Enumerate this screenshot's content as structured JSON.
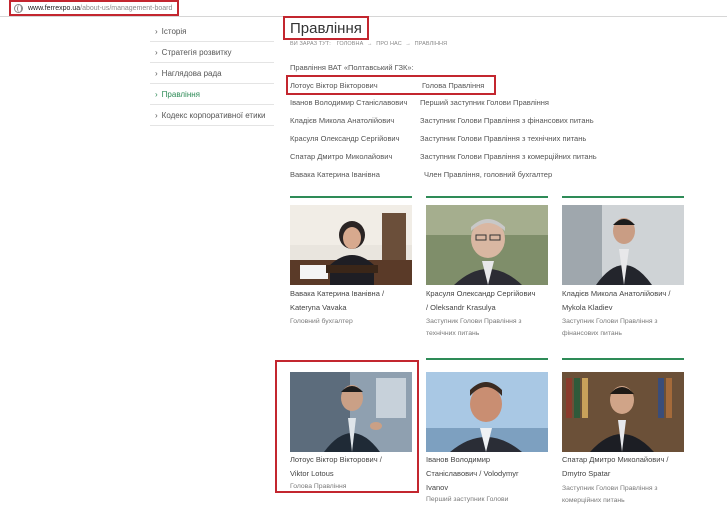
{
  "browser": {
    "url_host": "www.ferrexpo.ua",
    "url_path": "/about-us/management-board"
  },
  "sidebar": {
    "items": [
      {
        "label": "Історія",
        "active": false
      },
      {
        "label": "Стратегія розвитку",
        "active": false
      },
      {
        "label": "Наглядова рада",
        "active": false
      },
      {
        "label": "Правління",
        "active": true
      },
      {
        "label": "Кодекс корпоративної етики",
        "active": false
      }
    ]
  },
  "page": {
    "title": "Правління",
    "breadcrumb": [
      "Ви зараз тут:",
      "Головна",
      "Про нас",
      "Правління"
    ],
    "org_line": "Правління ВАТ «Полтавський ГЗК»:"
  },
  "board": [
    {
      "name": "Лотоус Віктор Вікторович",
      "position": "Голова Правління"
    },
    {
      "name": "Іванов Володимир Станіславович",
      "position": "Перший заступник Голови Правління"
    },
    {
      "name": "Кладієв Микола Анатолійович",
      "position": "Заступник Голови Правління  з фінансових питань"
    },
    {
      "name": "Красуля Олександр Сергійович",
      "position": "Заступник Голови Правління  з технічних питань"
    },
    {
      "name": "Спатар Дмитро Миколайович",
      "position": "Заступник Голови Правління  з комерційних питань"
    },
    {
      "name": "Вавака Катерина Іванівна",
      "position": "Член Правління, головний бухгалтер"
    }
  ],
  "cards": [
    {
      "name_lines": [
        "Вавака Катерина Іванівна /",
        "Kateryna Vavaka"
      ],
      "pos_lines": [
        "Головний бухгалтер"
      ],
      "photo": "woman-at-desk"
    },
    {
      "name_lines": [
        "Красуля Олександр Сергійович",
        "/ Oleksandr Krasulya"
      ],
      "pos_lines": [
        "Заступник Голови Правління з",
        "технічних питань"
      ],
      "photo": "man-glasses-outdoor"
    },
    {
      "name_lines": [
        "Кладієв Микола Анатолійович /",
        "Mykola Kladiev"
      ],
      "pos_lines": [
        "Заступник Голови Правління з",
        "фінансових питань"
      ],
      "photo": "man-office"
    },
    {
      "name_lines": [
        "Лотоус Віктор Вікторович /",
        "Viktor Lotous"
      ],
      "pos_lines": [
        "Голова Правління"
      ],
      "photo": "man-gesturing"
    },
    {
      "name_lines": [
        "Іванов Володимир",
        "Станіславович / Volodymyr",
        "Ivanov"
      ],
      "pos_lines": [
        "Перший заступник Голови"
      ],
      "photo": "man-sky"
    },
    {
      "name_lines": [
        "Спатар Дмитро Миколайович /",
        "Dmytro Spatar"
      ],
      "pos_lines": [
        "Заступник Голови Правління з",
        "комерційних питань"
      ],
      "photo": "man-bookshelf"
    }
  ],
  "colors": {
    "accent_green": "#2e8b57",
    "highlight_red": "#c3262f"
  }
}
